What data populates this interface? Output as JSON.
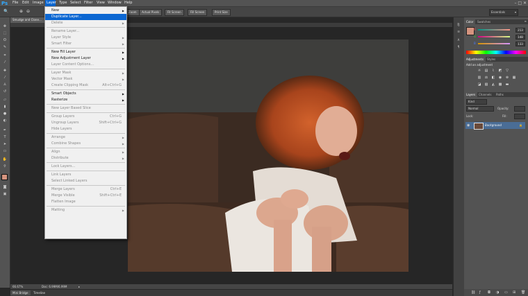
{
  "app": {
    "logo": "Ps"
  },
  "menubar": {
    "items": [
      "File",
      "Edit",
      "Image",
      "Layer",
      "Type",
      "Select",
      "Filter",
      "View",
      "Window",
      "Help"
    ],
    "window_controls": "–  □  ✕"
  },
  "options": {
    "buttons": [
      "Zoom",
      "Actual Pixels",
      "Fit Screen",
      "Fill Screen",
      "Print Size"
    ],
    "workspace": "Essentials"
  },
  "document": {
    "tab_label": "Smudge and Clone...",
    "zoom": "66.67%",
    "doc_info": "Doc: 6.99M/6.99M"
  },
  "bottom_tabs": [
    "Mini Bridge",
    "Timeline"
  ],
  "layer_menu": [
    {
      "label": "New",
      "arrow": true,
      "enabled": true
    },
    {
      "label": "Duplicate Layer...",
      "highlight": true,
      "enabled": true
    },
    {
      "label": "Delete",
      "arrow": true,
      "enabled": false
    },
    {
      "sep": true
    },
    {
      "label": "Rename Layer...",
      "enabled": false
    },
    {
      "label": "Layer Style",
      "arrow": true,
      "enabled": false
    },
    {
      "label": "Smart Filter",
      "arrow": true,
      "enabled": false
    },
    {
      "sep": true
    },
    {
      "label": "New Fill Layer",
      "arrow": true,
      "enabled": true
    },
    {
      "label": "New Adjustment Layer",
      "arrow": true,
      "enabled": true
    },
    {
      "label": "Layer Content Options...",
      "enabled": false
    },
    {
      "sep": true
    },
    {
      "label": "Layer Mask",
      "arrow": true,
      "enabled": false
    },
    {
      "label": "Vector Mask",
      "arrow": true,
      "enabled": false
    },
    {
      "label": "Create Clipping Mask",
      "shortcut": "Alt+Ctrl+G",
      "enabled": false
    },
    {
      "sep": true
    },
    {
      "label": "Smart Objects",
      "arrow": true,
      "enabled": true
    },
    {
      "label": "Rasterize",
      "arrow": true,
      "enabled": true
    },
    {
      "sep": true
    },
    {
      "label": "New Layer Based Slice",
      "enabled": false
    },
    {
      "sep": true
    },
    {
      "label": "Group Layers",
      "shortcut": "Ctrl+G",
      "enabled": false
    },
    {
      "label": "Ungroup Layers",
      "shortcut": "Shift+Ctrl+G",
      "enabled": false
    },
    {
      "label": "Hide Layers",
      "enabled": false
    },
    {
      "sep": true
    },
    {
      "label": "Arrange",
      "arrow": true,
      "enabled": false
    },
    {
      "label": "Combine Shapes",
      "arrow": true,
      "enabled": false
    },
    {
      "sep": true
    },
    {
      "label": "Align",
      "arrow": true,
      "enabled": false
    },
    {
      "label": "Distribute",
      "arrow": true,
      "enabled": false
    },
    {
      "sep": true
    },
    {
      "label": "Lock Layers...",
      "enabled": false
    },
    {
      "sep": true
    },
    {
      "label": "Link Layers",
      "enabled": false
    },
    {
      "label": "Select Linked Layers",
      "enabled": false
    },
    {
      "sep": true
    },
    {
      "label": "Merge Layers",
      "shortcut": "Ctrl+E",
      "enabled": false
    },
    {
      "label": "Merge Visible",
      "shortcut": "Shift+Ctrl+E",
      "enabled": false
    },
    {
      "label": "Flatten Image",
      "enabled": false
    },
    {
      "sep": true
    },
    {
      "label": "Matting",
      "arrow": true,
      "enabled": false
    }
  ],
  "color_panel": {
    "tabs": [
      "Color",
      "Swatches"
    ],
    "channels": [
      {
        "label": "R",
        "value": "213",
        "color": "#ff4a4a"
      },
      {
        "label": "G",
        "value": "148",
        "color": "#3fd13f"
      },
      {
        "label": "B",
        "value": "133",
        "color": "#4a7dff"
      }
    ],
    "foreground": "#d5947f",
    "background": "#ffffff"
  },
  "adjustments_panel": {
    "tabs": [
      "Adjustments",
      "Styles"
    ],
    "title": "Add an adjustment"
  },
  "layers_panel": {
    "tabs": [
      "Layers",
      "Channels",
      "Paths"
    ],
    "filter": "Kind",
    "blend_mode": "Normal",
    "opacity_label": "Opacity:",
    "lock_label": "Lock:",
    "fill_label": "Fill:",
    "layer_name": "Background"
  }
}
